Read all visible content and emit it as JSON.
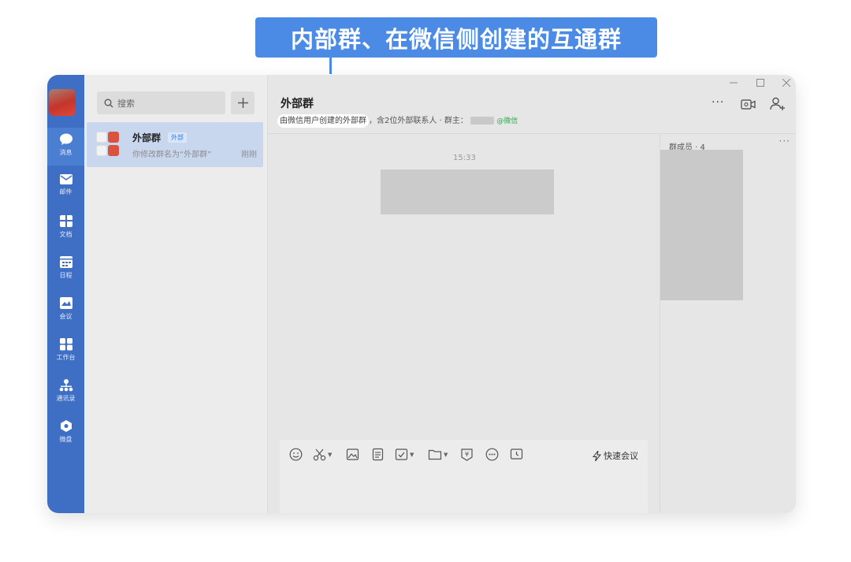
{
  "callout": {
    "text": "内部群、在微信侧创建的互通群"
  },
  "nav": {
    "items": [
      {
        "label": "消息",
        "icon": "message-icon"
      },
      {
        "label": "邮件",
        "icon": "mail-icon"
      },
      {
        "label": "文档",
        "icon": "doc-icon"
      },
      {
        "label": "日程",
        "icon": "calendar-icon"
      },
      {
        "label": "会议",
        "icon": "meeting-icon"
      },
      {
        "label": "工作台",
        "icon": "workbench-icon"
      },
      {
        "label": "通讯录",
        "icon": "contacts-icon"
      },
      {
        "label": "微盘",
        "icon": "drive-icon"
      }
    ]
  },
  "search": {
    "placeholder": "搜索"
  },
  "conversation": {
    "title": "外部群",
    "tag": "外部",
    "preview": "你修改群名为“外部群”",
    "time": "刚刚"
  },
  "chat": {
    "title": "外部群",
    "subtitle_highlight": "由微信用户创建的外部群",
    "subtitle_rest": "，含2位外部联系人 · 群主：",
    "owner_badge": "@微信",
    "timestamp": "15:33"
  },
  "composer": {
    "quick_meeting": "快速会议"
  },
  "members": {
    "title": "群成员 · 4",
    "more": "···"
  },
  "header_actions": {
    "more": "···"
  },
  "colors": {
    "accent": "#4b8be6",
    "nav_bg": "#3e6fc4",
    "selected_bg": "#c9d7ee"
  }
}
